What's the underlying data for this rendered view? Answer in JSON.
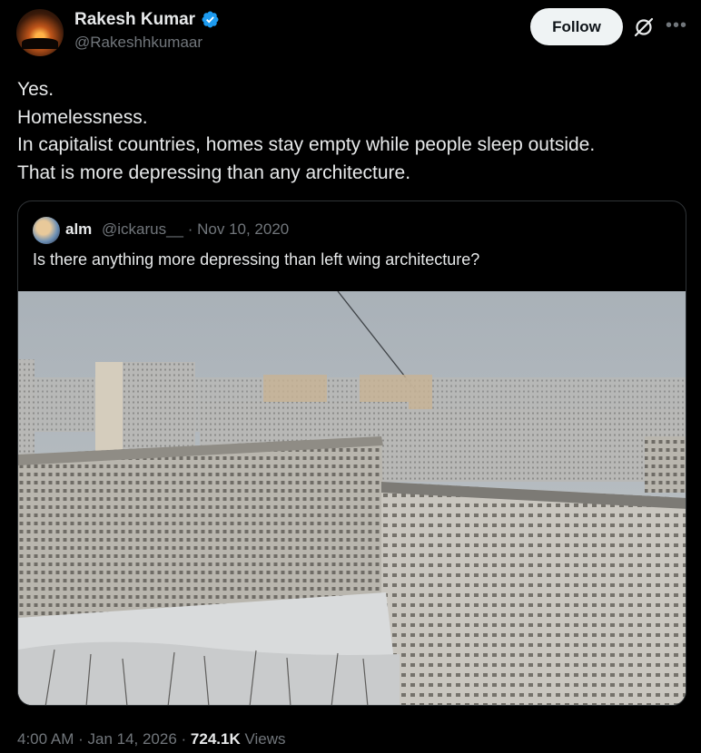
{
  "tweet": {
    "author_name": "Rakesh Kumar",
    "author_handle": "@Rakeshhkumaar",
    "follow_label": "Follow",
    "lines": [
      "Yes.",
      "Homelessness.",
      "In capitalist countries, homes stay empty while people sleep outside.",
      "That is more depressing than any architecture."
    ],
    "time": "4:00 AM",
    "date": "Jan 14, 2026",
    "views_count": "724.1K",
    "views_label": "Views"
  },
  "quoted": {
    "author_name": "alm",
    "author_handle": "@ickarus__",
    "date": "Nov 10, 2020",
    "text": "Is there anything more depressing than left wing architecture?"
  },
  "icons": {
    "verified": "verified-badge-icon",
    "grok": "grok-icon",
    "more": "more-icon"
  },
  "colors": {
    "background": "#000000",
    "text": "#e7e9ea",
    "secondary_text": "#71767b",
    "verified_blue": "#1d9bf0",
    "follow_bg": "#eff3f4"
  }
}
